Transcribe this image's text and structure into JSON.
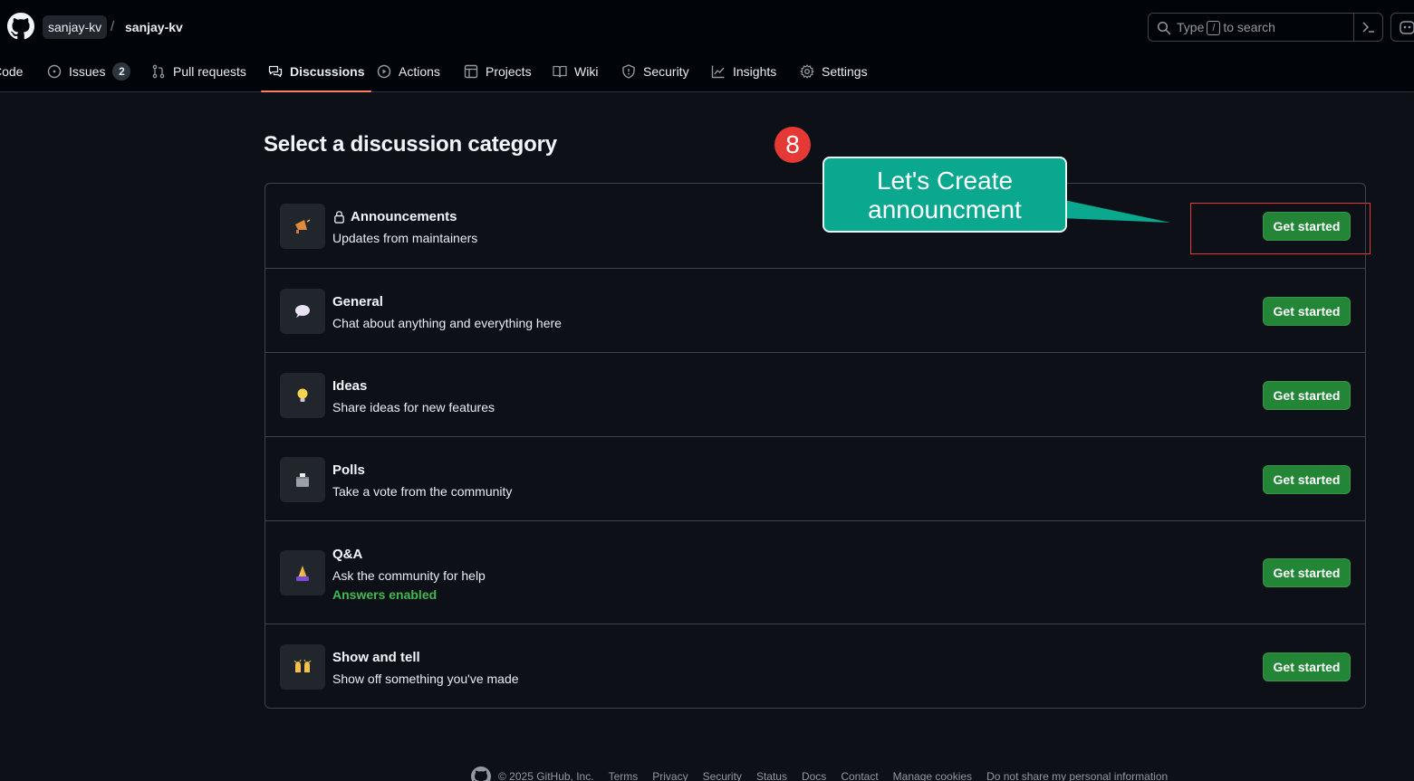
{
  "header": {
    "owner": "sanjay-kv",
    "separator": "/",
    "repo": "sanjay-kv",
    "search": {
      "prefix": "Type",
      "key": "/",
      "suffix": "to search"
    }
  },
  "nav": {
    "tabs": [
      {
        "label": "Code",
        "icon": "code-icon"
      },
      {
        "label": "Issues",
        "icon": "issue-opened-icon",
        "count": "2"
      },
      {
        "label": "Pull requests",
        "icon": "git-pull-request-icon"
      },
      {
        "label": "Discussions",
        "icon": "comment-discussion-icon",
        "active": true
      },
      {
        "label": "Actions",
        "icon": "play-icon"
      },
      {
        "label": "Projects",
        "icon": "table-icon"
      },
      {
        "label": "Wiki",
        "icon": "book-icon"
      },
      {
        "label": "Security",
        "icon": "shield-icon"
      },
      {
        "label": "Insights",
        "icon": "graph-icon"
      },
      {
        "label": "Settings",
        "icon": "gear-icon"
      }
    ]
  },
  "main": {
    "title": "Select a discussion category",
    "categories": [
      {
        "name": "Announcements",
        "description": "Updates from maintainers",
        "emoji": "loudspeaker-icon",
        "locked": true,
        "button": "Get started"
      },
      {
        "name": "General",
        "description": "Chat about anything and everything here",
        "emoji": "speech-balloon-icon",
        "button": "Get started"
      },
      {
        "name": "Ideas",
        "description": "Share ideas for new features",
        "emoji": "light-bulb-icon",
        "button": "Get started"
      },
      {
        "name": "Polls",
        "description": "Take a vote from the community",
        "emoji": "ballot-box-icon",
        "button": "Get started"
      },
      {
        "name": "Q&A",
        "description": "Ask the community for help",
        "extra": "Answers enabled",
        "emoji": "praying-hands-icon",
        "button": "Get started"
      },
      {
        "name": "Show and tell",
        "description": "Show off something you've made",
        "emoji": "raised-hands-icon",
        "button": "Get started"
      }
    ]
  },
  "annotation": {
    "step": "8",
    "callout_line1": "Let's Create",
    "callout_line2": "announcment"
  },
  "footer": {
    "copyright": "© 2025 GitHub, Inc.",
    "links": [
      "Terms",
      "Privacy",
      "Security",
      "Status",
      "Docs",
      "Contact",
      "Manage cookies",
      "Do not share my personal information"
    ]
  },
  "colors": {
    "background": "#0d1117",
    "header_bg": "#010409",
    "border": "#3d444d",
    "button_green": "#238636",
    "answers_green": "#3fb950",
    "active_tab_underline": "#f78166",
    "callout_teal": "#0aa88f",
    "badge_red": "#e53935",
    "highlight_red": "#e5383b"
  }
}
